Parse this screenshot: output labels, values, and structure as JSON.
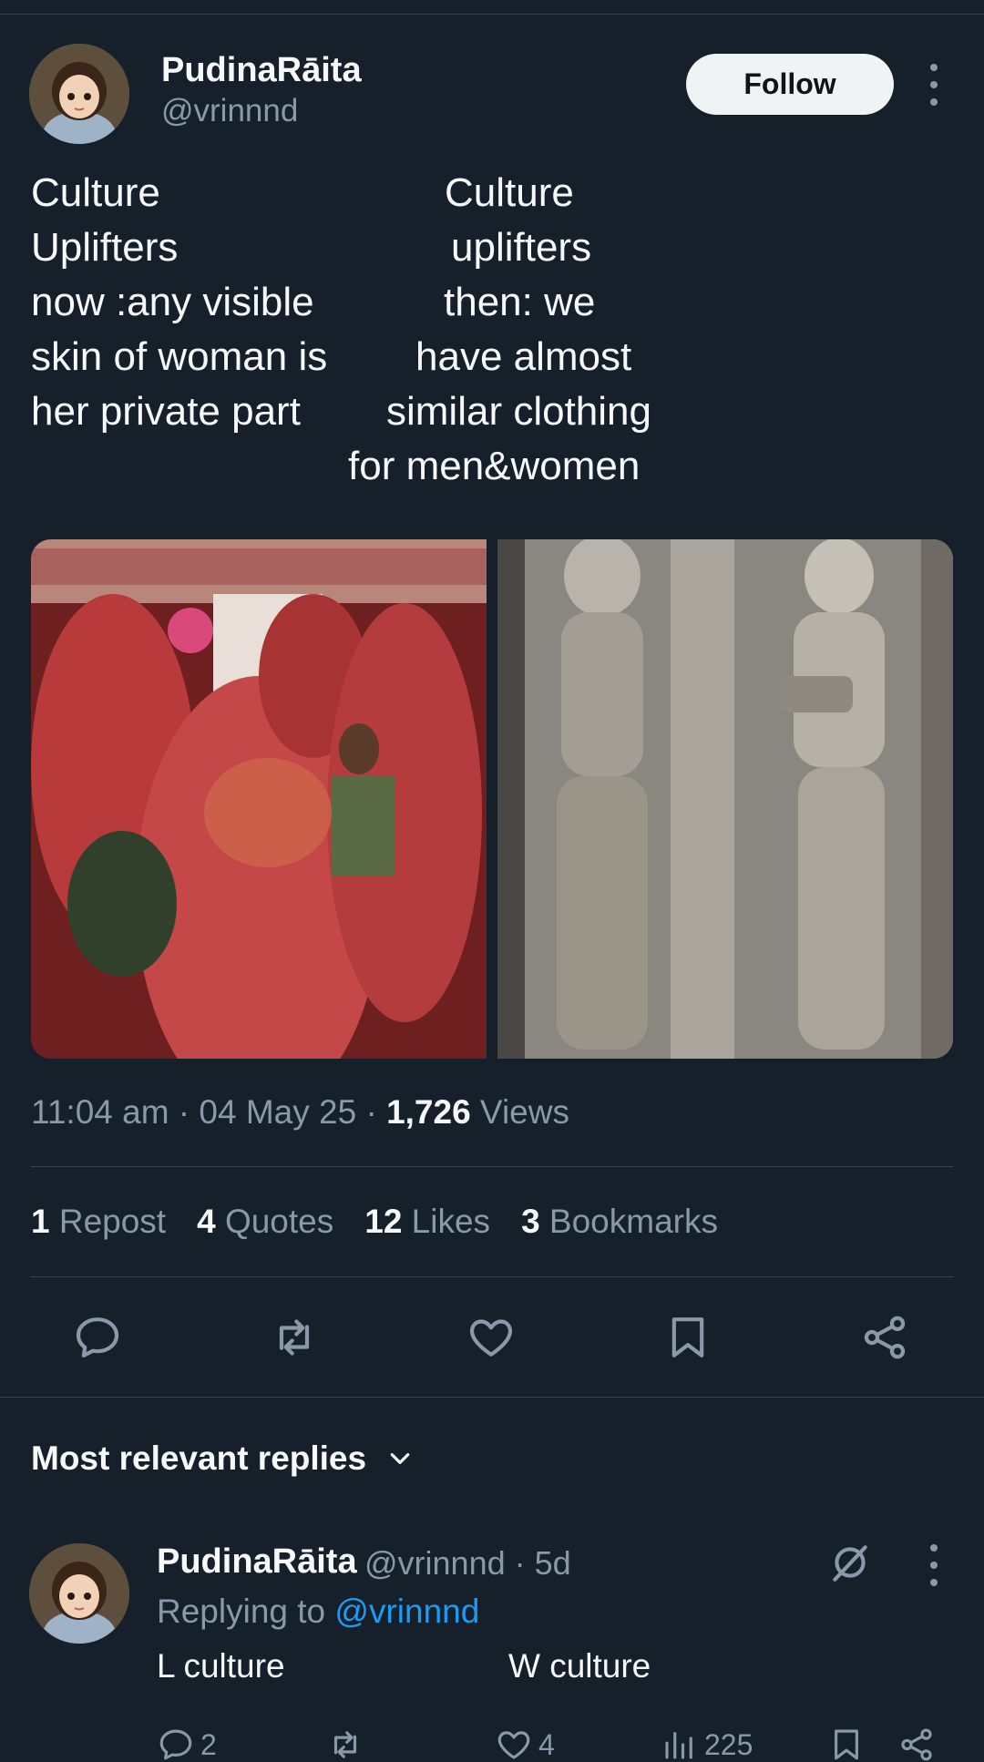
{
  "post": {
    "author_name": "PudinaRāita",
    "author_handle": "@vrinnnd",
    "follow_label": "Follow",
    "text_lines": [
      "Culture",
      "Culture",
      "Uplifters",
      "uplifters",
      "now :any visible",
      "then: we",
      "skin of woman is",
      "have almost",
      "her private part",
      "similar clothing",
      "for men&women"
    ],
    "timestamp": "11:04 am · 04 May 25 · ",
    "views_count": "1,726",
    "views_label": " Views"
  },
  "stats": {
    "reposts": {
      "count": "1",
      "label": " Repost"
    },
    "quotes": {
      "count": "4",
      "label": " Quotes"
    },
    "likes": {
      "count": "12",
      "label": " Likes"
    },
    "bookmarks": {
      "count": "3",
      "label": " Bookmarks"
    }
  },
  "replies": {
    "header": "Most relevant replies",
    "items": [
      {
        "author_name": "PudinaRāita",
        "meta": "@vrinnnd · 5d",
        "replying_prefix": "Replying to ",
        "replying_to": "@vrinnnd",
        "text_left": "L culture",
        "text_right": "W culture",
        "replies": "2",
        "likes": "4",
        "views": "225"
      }
    ]
  },
  "colors": {
    "background": "#15202b",
    "text": "#f7f9f9",
    "muted": "#8b98a5",
    "link": "#1d9bf0",
    "divider": "#38444d"
  }
}
